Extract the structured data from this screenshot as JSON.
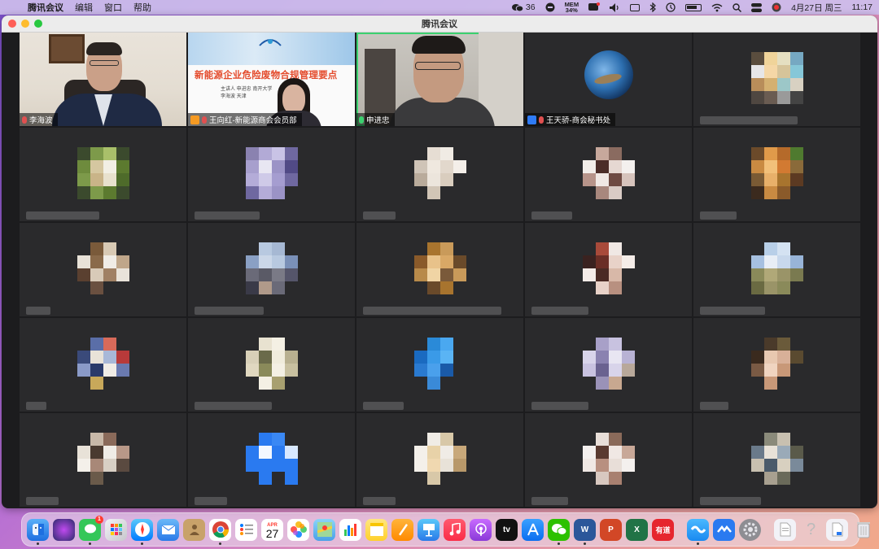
{
  "menubar": {
    "app_name": "腾讯会议",
    "menus": [
      "编辑",
      "窗口",
      "帮助"
    ],
    "wechat_count": "36",
    "meter_top": "MEM",
    "meter_value": "34%",
    "datetime": "4月27日 周三",
    "time": "11:17"
  },
  "window": {
    "title": "腾讯会议"
  },
  "tiles": {
    "t1": {
      "name": "李海波"
    },
    "t2": {
      "name": "王向红-新能源商会会员部",
      "slide_title": "新能源企业危险废物合规管理要点",
      "slide_meta": "主讲人  申进忠  南开大学",
      "slide_meta2": "李海波  天津"
    },
    "t3": {
      "name": "申进忠"
    },
    "t4": {
      "name": "王天骄-商会秘书处"
    }
  },
  "dock": {
    "calendar_day": "27",
    "calendar_month": "APR",
    "messages_badge": "1",
    "tv_label": "tv",
    "youdao_label": "有道",
    "word_label": "W",
    "ppt_label": "P",
    "excel_label": "X",
    "help_label": "?"
  },
  "icons": {
    "apple": "apple-icon",
    "wifi": "wifi-icon",
    "bluetooth": "bluetooth-icon",
    "search": "search-icon"
  }
}
